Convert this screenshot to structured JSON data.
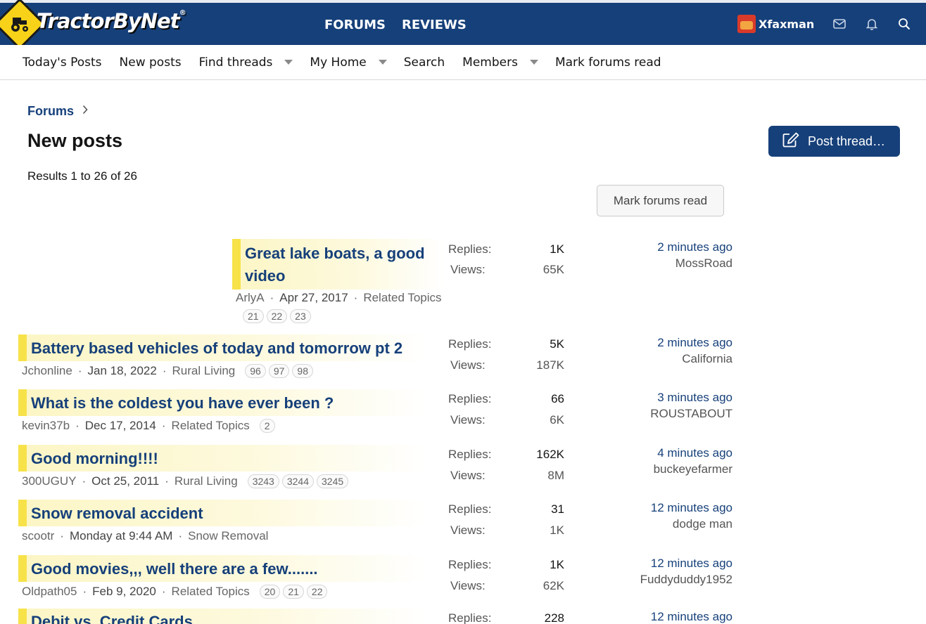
{
  "header": {
    "logo_text": "TractorByNet",
    "logo_reg": "®",
    "nav": [
      "FORUMS",
      "REVIEWS"
    ],
    "username": "Xfaxman"
  },
  "subnav": {
    "todays_posts": "Today's Posts",
    "new_posts": "New posts",
    "find_threads": "Find threads",
    "my_home": "My Home",
    "search": "Search",
    "members": "Members",
    "mark_forums_read": "Mark forums read"
  },
  "breadcrumb": {
    "forums": "Forums"
  },
  "page": {
    "title": "New posts",
    "post_thread": "Post thread…",
    "results": "Results 1 to 26 of 26",
    "mark_forums_read": "Mark forums read"
  },
  "stat_labels": {
    "replies": "Replies:",
    "views": "Views:"
  },
  "threads": [
    {
      "title_line1": "Great lake boats, a good",
      "title_line2": "video",
      "author": "ArlyA",
      "date": "Apr 27, 2017",
      "forum": "Related Topics",
      "pages": [
        "21",
        "22",
        "23"
      ],
      "replies": "1K",
      "views": "65K",
      "last_time": "2 minutes ago",
      "last_user": "MossRoad"
    },
    {
      "title": "Battery based vehicles of today and tomorrow pt 2",
      "author": "Jchonline",
      "date": "Jan 18, 2022",
      "forum": "Rural Living",
      "pages": [
        "96",
        "97",
        "98"
      ],
      "replies": "5K",
      "views": "187K",
      "last_time": "2 minutes ago",
      "last_user": "California"
    },
    {
      "title": "What is the coldest you have ever been ?",
      "author": "kevin37b",
      "date": "Dec 17, 2014",
      "forum": "Related Topics",
      "pages": [
        "2"
      ],
      "replies": "66",
      "views": "6K",
      "last_time": "3 minutes ago",
      "last_user": "ROUSTABOUT"
    },
    {
      "title": "Good morning!!!!",
      "author": "300UGUY",
      "date": "Oct 25, 2011",
      "forum": "Rural Living",
      "pages": [
        "3243",
        "3244",
        "3245"
      ],
      "replies": "162K",
      "views": "8M",
      "last_time": "4 minutes ago",
      "last_user": "buckeyefarmer"
    },
    {
      "title": "Snow removal accident",
      "author": "scootr",
      "date": "Monday at 9:44 AM",
      "forum": "Snow Removal",
      "pages": [],
      "replies": "31",
      "views": "1K",
      "last_time": "12 minutes ago",
      "last_user": "dodge man"
    },
    {
      "title": "Good movies,,, well there are a few.......",
      "author": "Oldpath05",
      "date": "Feb 9, 2020",
      "forum": "Related Topics",
      "pages": [
        "20",
        "21",
        "22"
      ],
      "replies": "1K",
      "views": "62K",
      "last_time": "12 minutes ago",
      "last_user": "Fuddyduddy1952"
    },
    {
      "title": "Debit vs. Credit Cards",
      "replies": "228",
      "last_time": "12 minutes ago"
    }
  ]
}
